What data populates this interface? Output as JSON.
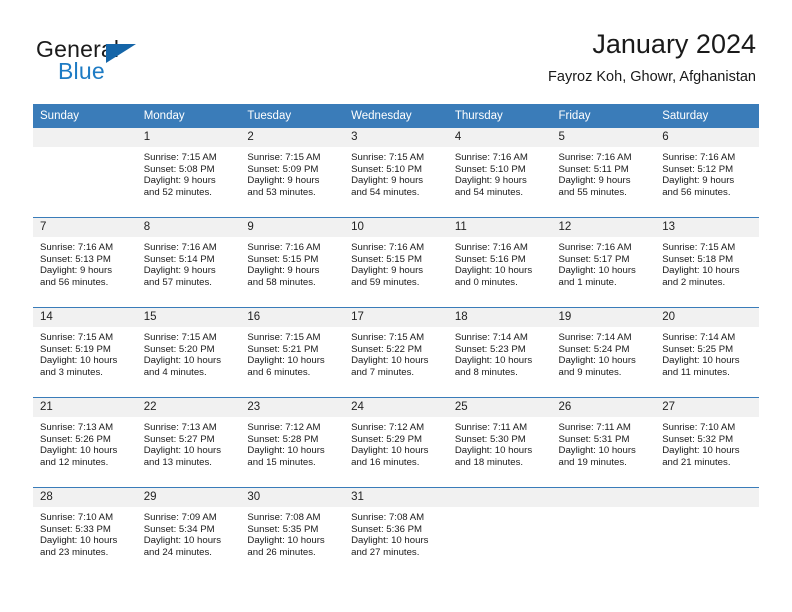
{
  "logo": {
    "word_one": "General",
    "word_two": "Blue",
    "triangle_color": "#1565a8",
    "blue_color": "#1d7bc4"
  },
  "header": {
    "title": "January 2024",
    "subtitle": "Fayroz Koh, Ghowr, Afghanistan"
  },
  "colors": {
    "header_blue": "#3a7cb9",
    "daynum_band": "#f1f1f1",
    "grid_line": "#3a7cb9"
  },
  "weekdays": [
    "Sunday",
    "Monday",
    "Tuesday",
    "Wednesday",
    "Thursday",
    "Friday",
    "Saturday"
  ],
  "weeks": [
    [
      {
        "day": "",
        "sunrise": "",
        "sunset": "",
        "daylight_line1": "",
        "daylight_line2": ""
      },
      {
        "day": "1",
        "sunrise": "Sunrise: 7:15 AM",
        "sunset": "Sunset: 5:08 PM",
        "daylight_line1": "Daylight: 9 hours",
        "daylight_line2": "and 52 minutes."
      },
      {
        "day": "2",
        "sunrise": "Sunrise: 7:15 AM",
        "sunset": "Sunset: 5:09 PM",
        "daylight_line1": "Daylight: 9 hours",
        "daylight_line2": "and 53 minutes."
      },
      {
        "day": "3",
        "sunrise": "Sunrise: 7:15 AM",
        "sunset": "Sunset: 5:10 PM",
        "daylight_line1": "Daylight: 9 hours",
        "daylight_line2": "and 54 minutes."
      },
      {
        "day": "4",
        "sunrise": "Sunrise: 7:16 AM",
        "sunset": "Sunset: 5:10 PM",
        "daylight_line1": "Daylight: 9 hours",
        "daylight_line2": "and 54 minutes."
      },
      {
        "day": "5",
        "sunrise": "Sunrise: 7:16 AM",
        "sunset": "Sunset: 5:11 PM",
        "daylight_line1": "Daylight: 9 hours",
        "daylight_line2": "and 55 minutes."
      },
      {
        "day": "6",
        "sunrise": "Sunrise: 7:16 AM",
        "sunset": "Sunset: 5:12 PM",
        "daylight_line1": "Daylight: 9 hours",
        "daylight_line2": "and 56 minutes."
      }
    ],
    [
      {
        "day": "7",
        "sunrise": "Sunrise: 7:16 AM",
        "sunset": "Sunset: 5:13 PM",
        "daylight_line1": "Daylight: 9 hours",
        "daylight_line2": "and 56 minutes."
      },
      {
        "day": "8",
        "sunrise": "Sunrise: 7:16 AM",
        "sunset": "Sunset: 5:14 PM",
        "daylight_line1": "Daylight: 9 hours",
        "daylight_line2": "and 57 minutes."
      },
      {
        "day": "9",
        "sunrise": "Sunrise: 7:16 AM",
        "sunset": "Sunset: 5:15 PM",
        "daylight_line1": "Daylight: 9 hours",
        "daylight_line2": "and 58 minutes."
      },
      {
        "day": "10",
        "sunrise": "Sunrise: 7:16 AM",
        "sunset": "Sunset: 5:15 PM",
        "daylight_line1": "Daylight: 9 hours",
        "daylight_line2": "and 59 minutes."
      },
      {
        "day": "11",
        "sunrise": "Sunrise: 7:16 AM",
        "sunset": "Sunset: 5:16 PM",
        "daylight_line1": "Daylight: 10 hours",
        "daylight_line2": "and 0 minutes."
      },
      {
        "day": "12",
        "sunrise": "Sunrise: 7:16 AM",
        "sunset": "Sunset: 5:17 PM",
        "daylight_line1": "Daylight: 10 hours",
        "daylight_line2": "and 1 minute."
      },
      {
        "day": "13",
        "sunrise": "Sunrise: 7:15 AM",
        "sunset": "Sunset: 5:18 PM",
        "daylight_line1": "Daylight: 10 hours",
        "daylight_line2": "and 2 minutes."
      }
    ],
    [
      {
        "day": "14",
        "sunrise": "Sunrise: 7:15 AM",
        "sunset": "Sunset: 5:19 PM",
        "daylight_line1": "Daylight: 10 hours",
        "daylight_line2": "and 3 minutes."
      },
      {
        "day": "15",
        "sunrise": "Sunrise: 7:15 AM",
        "sunset": "Sunset: 5:20 PM",
        "daylight_line1": "Daylight: 10 hours",
        "daylight_line2": "and 4 minutes."
      },
      {
        "day": "16",
        "sunrise": "Sunrise: 7:15 AM",
        "sunset": "Sunset: 5:21 PM",
        "daylight_line1": "Daylight: 10 hours",
        "daylight_line2": "and 6 minutes."
      },
      {
        "day": "17",
        "sunrise": "Sunrise: 7:15 AM",
        "sunset": "Sunset: 5:22 PM",
        "daylight_line1": "Daylight: 10 hours",
        "daylight_line2": "and 7 minutes."
      },
      {
        "day": "18",
        "sunrise": "Sunrise: 7:14 AM",
        "sunset": "Sunset: 5:23 PM",
        "daylight_line1": "Daylight: 10 hours",
        "daylight_line2": "and 8 minutes."
      },
      {
        "day": "19",
        "sunrise": "Sunrise: 7:14 AM",
        "sunset": "Sunset: 5:24 PM",
        "daylight_line1": "Daylight: 10 hours",
        "daylight_line2": "and 9 minutes."
      },
      {
        "day": "20",
        "sunrise": "Sunrise: 7:14 AM",
        "sunset": "Sunset: 5:25 PM",
        "daylight_line1": "Daylight: 10 hours",
        "daylight_line2": "and 11 minutes."
      }
    ],
    [
      {
        "day": "21",
        "sunrise": "Sunrise: 7:13 AM",
        "sunset": "Sunset: 5:26 PM",
        "daylight_line1": "Daylight: 10 hours",
        "daylight_line2": "and 12 minutes."
      },
      {
        "day": "22",
        "sunrise": "Sunrise: 7:13 AM",
        "sunset": "Sunset: 5:27 PM",
        "daylight_line1": "Daylight: 10 hours",
        "daylight_line2": "and 13 minutes."
      },
      {
        "day": "23",
        "sunrise": "Sunrise: 7:12 AM",
        "sunset": "Sunset: 5:28 PM",
        "daylight_line1": "Daylight: 10 hours",
        "daylight_line2": "and 15 minutes."
      },
      {
        "day": "24",
        "sunrise": "Sunrise: 7:12 AM",
        "sunset": "Sunset: 5:29 PM",
        "daylight_line1": "Daylight: 10 hours",
        "daylight_line2": "and 16 minutes."
      },
      {
        "day": "25",
        "sunrise": "Sunrise: 7:11 AM",
        "sunset": "Sunset: 5:30 PM",
        "daylight_line1": "Daylight: 10 hours",
        "daylight_line2": "and 18 minutes."
      },
      {
        "day": "26",
        "sunrise": "Sunrise: 7:11 AM",
        "sunset": "Sunset: 5:31 PM",
        "daylight_line1": "Daylight: 10 hours",
        "daylight_line2": "and 19 minutes."
      },
      {
        "day": "27",
        "sunrise": "Sunrise: 7:10 AM",
        "sunset": "Sunset: 5:32 PM",
        "daylight_line1": "Daylight: 10 hours",
        "daylight_line2": "and 21 minutes."
      }
    ],
    [
      {
        "day": "28",
        "sunrise": "Sunrise: 7:10 AM",
        "sunset": "Sunset: 5:33 PM",
        "daylight_line1": "Daylight: 10 hours",
        "daylight_line2": "and 23 minutes."
      },
      {
        "day": "29",
        "sunrise": "Sunrise: 7:09 AM",
        "sunset": "Sunset: 5:34 PM",
        "daylight_line1": "Daylight: 10 hours",
        "daylight_line2": "and 24 minutes."
      },
      {
        "day": "30",
        "sunrise": "Sunrise: 7:08 AM",
        "sunset": "Sunset: 5:35 PM",
        "daylight_line1": "Daylight: 10 hours",
        "daylight_line2": "and 26 minutes."
      },
      {
        "day": "31",
        "sunrise": "Sunrise: 7:08 AM",
        "sunset": "Sunset: 5:36 PM",
        "daylight_line1": "Daylight: 10 hours",
        "daylight_line2": "and 27 minutes."
      },
      {
        "day": "",
        "sunrise": "",
        "sunset": "",
        "daylight_line1": "",
        "daylight_line2": ""
      },
      {
        "day": "",
        "sunrise": "",
        "sunset": "",
        "daylight_line1": "",
        "daylight_line2": ""
      },
      {
        "day": "",
        "sunrise": "",
        "sunset": "",
        "daylight_line1": "",
        "daylight_line2": ""
      }
    ]
  ]
}
